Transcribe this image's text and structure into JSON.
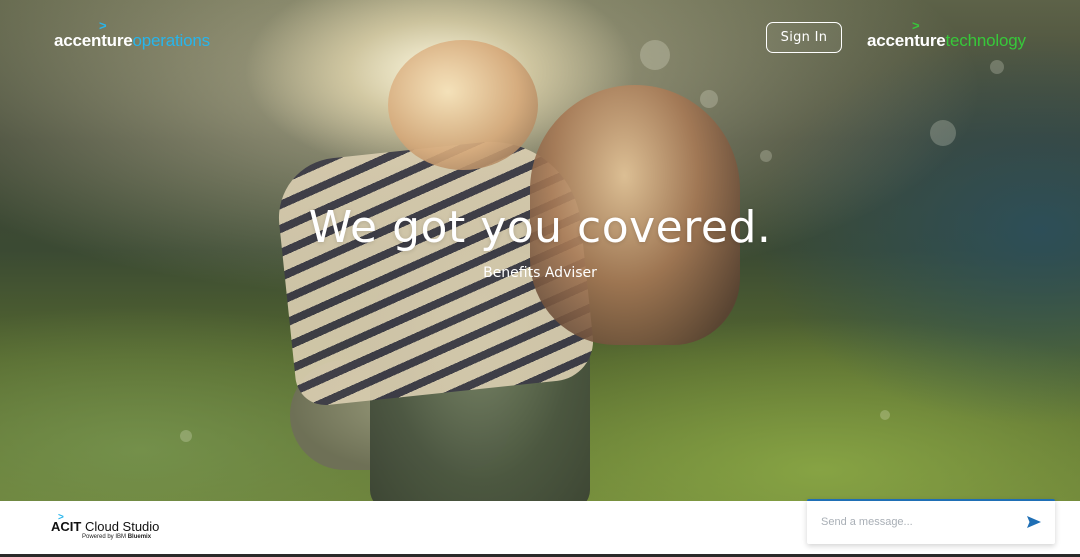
{
  "header": {
    "logo_left": {
      "brand": "accenture",
      "suffix": "operations",
      "arrow": ">"
    },
    "logo_right": {
      "brand": "accenture",
      "suffix": "technology",
      "arrow": ">"
    },
    "signin_label": "Sign In"
  },
  "hero": {
    "headline": "We got you covered.",
    "subtitle": "Benefits Adviser"
  },
  "footer": {
    "product": {
      "arrow": ">",
      "name_bold": "ACIT",
      "name_rest": " Cloud Studio",
      "powered_prefix": "Powered by IBM ",
      "powered_brand": "Bluemix"
    },
    "chat": {
      "placeholder": "Send a message...",
      "value": "",
      "send_icon": "send-icon"
    }
  },
  "colors": {
    "operations": "#27b5ec",
    "technology": "#37c83a",
    "chat_accent": "#1f6fb5"
  }
}
